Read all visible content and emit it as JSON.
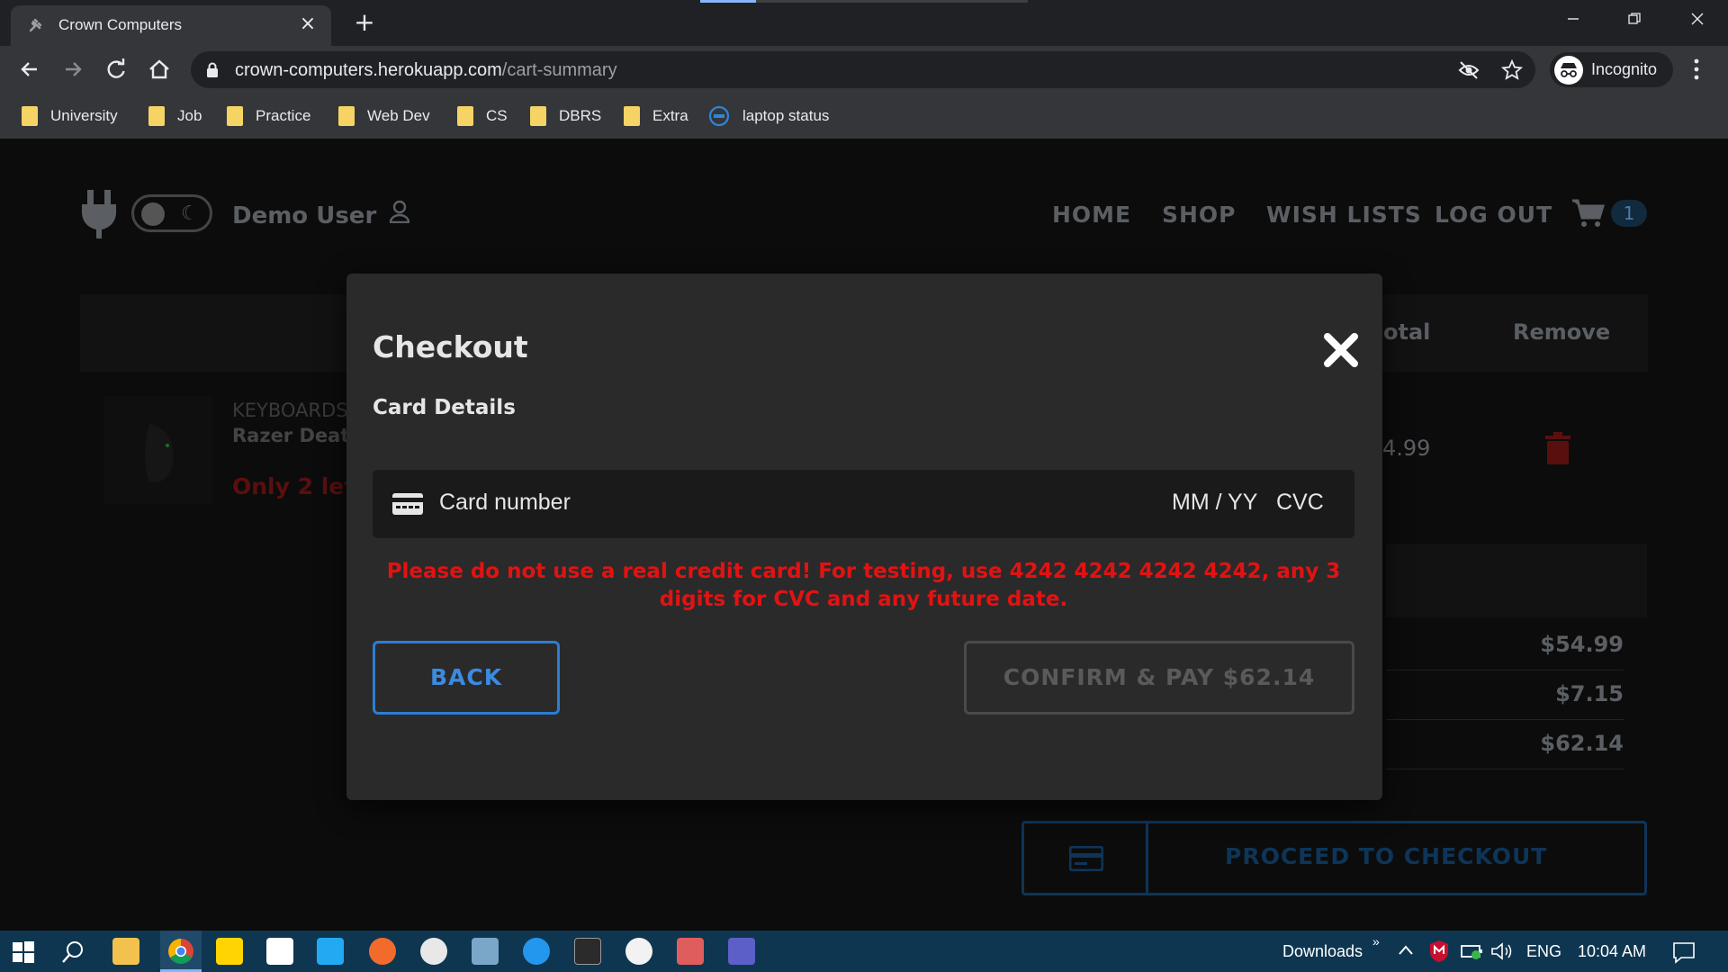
{
  "browser": {
    "tab_title": "Crown Computers",
    "tab_close": "×",
    "new_tab": "+",
    "progress": 0.17,
    "url_host": "crown-computers.herokuapp.com",
    "url_path": "/cart-summary",
    "incognito_label": "Incognito",
    "bookmarks": [
      "University",
      "Job",
      "Practice",
      "Web Dev",
      "CS",
      "DBRS",
      "Extra",
      "laptop status"
    ]
  },
  "site": {
    "user_label": "Demo User",
    "nav": [
      "HOME",
      "SHOP",
      "WISH LISTS",
      "LOG OUT"
    ],
    "cart_count": "1",
    "background": {
      "col_total": "otal",
      "col_remove": "Remove",
      "item_category": "KEYBOARDS",
      "item_name": "Razer Death",
      "item_stock": "Only 2 lef",
      "item_price": "4.99",
      "summary_values": [
        "$54.99",
        "$7.15",
        "$62.14"
      ],
      "proceed_label": "PROCEED TO CHECKOUT"
    }
  },
  "modal": {
    "title": "Checkout",
    "subtitle": "Card Details",
    "card_placeholder": "Card number",
    "exp_placeholder": "MM / YY",
    "cvc_placeholder": "CVC",
    "warning": "Please do not use a real credit card! For testing, use 4242 4242 4242 4242, any 3 digits for CVC and any future date.",
    "back_label": "BACK",
    "pay_label": "CONFIRM & PAY $62.14"
  },
  "taskbar": {
    "downloads_label": "Downloads",
    "language": "ENG",
    "time": "10:04 AM"
  },
  "colors": {
    "accent": "#2d7dd2",
    "warning": "#e31212",
    "taskbar": "#0f3651"
  }
}
